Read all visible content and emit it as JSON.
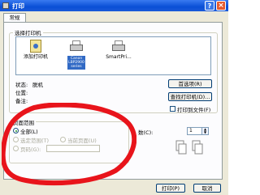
{
  "window": {
    "title": "打印"
  },
  "tabs": [
    {
      "label": "常规"
    }
  ],
  "select_printer": {
    "group_label": "选择打印机",
    "printers": [
      {
        "label": "添加打印机"
      },
      {
        "label": "Canon LBP2900 series"
      },
      {
        "label": "SmartPri..."
      }
    ]
  },
  "status": {
    "status_label": "状态:",
    "status_value": "脱机",
    "location_label": "位置:",
    "comment_label": "备注:"
  },
  "buttons": {
    "preferences": "首选项(R)",
    "find_printer": "查找打印机(D)...",
    "print_to_file": "打印到文件(F)",
    "print": "打印(P)",
    "cancel": "取消"
  },
  "page_range": {
    "group_label": "页面范围",
    "all": "全部(L)",
    "selection": "选定范围(T)",
    "current_page": "当前页面(U)",
    "pages": "页码(G):"
  },
  "copies": {
    "label": "数(C):",
    "value": "1"
  },
  "colors": {
    "annotation": "#e8141b",
    "title_bar": "#0a4fd6"
  }
}
